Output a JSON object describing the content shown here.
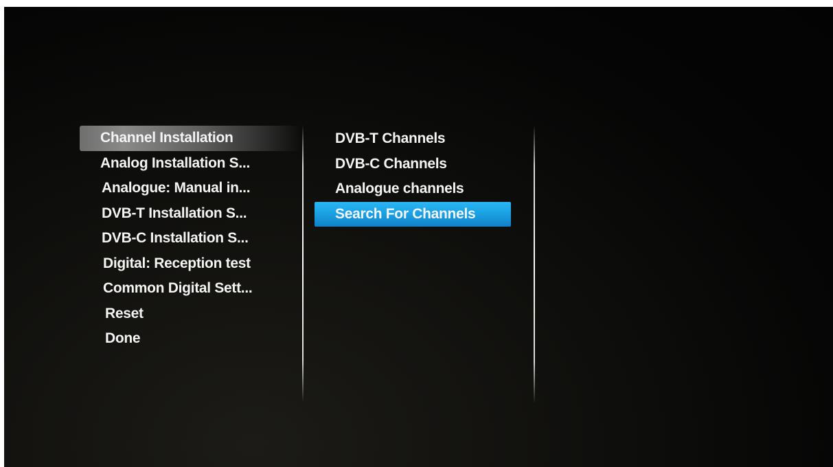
{
  "left_menu": {
    "items": [
      {
        "label": "Channel Installation"
      },
      {
        "label": "Analog Installation S..."
      },
      {
        "label": "Analogue: Manual in..."
      },
      {
        "label": "DVB-T Installation S..."
      },
      {
        "label": "DVB-C Installation S..."
      },
      {
        "label": "Digital: Reception test"
      },
      {
        "label": "Common Digital Sett..."
      },
      {
        "label": "Reset"
      },
      {
        "label": "Done"
      }
    ],
    "selected_index": 0
  },
  "sub_menu": {
    "items": [
      {
        "label": "DVB-T Channels"
      },
      {
        "label": "DVB-C Channels"
      },
      {
        "label": "Analogue channels"
      },
      {
        "label": "Search For Channels"
      }
    ],
    "highlighted_index": 3
  },
  "colors": {
    "highlight": "#1a9fe2",
    "selected_background": "#6f6f6f",
    "text": "#f4f4f4",
    "background": "#050505"
  }
}
